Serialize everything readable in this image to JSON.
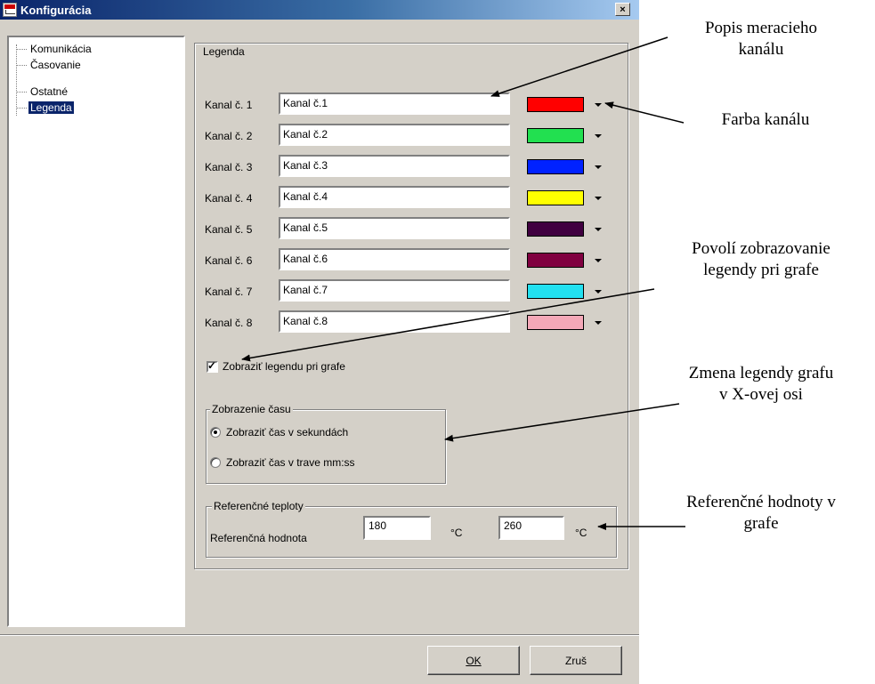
{
  "window": {
    "title": "Konfigurácia",
    "close_label": "×"
  },
  "tree": {
    "items": [
      {
        "label": "Komunikácia",
        "selected": false
      },
      {
        "label": "Časovanie",
        "selected": false
      },
      {
        "label": "Ostatné",
        "selected": false
      },
      {
        "label": "Legenda",
        "selected": true
      }
    ]
  },
  "legenda": {
    "group_label": "Legenda",
    "channels": [
      {
        "label": "Kanal č. 1",
        "value": "Kanal č.1",
        "color": "#ff0000"
      },
      {
        "label": "Kanal č. 2",
        "value": "Kanal č.2",
        "color": "#22e050"
      },
      {
        "label": "Kanal č. 3",
        "value": "Kanal č.3",
        "color": "#0022ff"
      },
      {
        "label": "Kanal č. 4",
        "value": "Kanal č.4",
        "color": "#ffff00"
      },
      {
        "label": "Kanal č. 5",
        "value": "Kanal č.5",
        "color": "#400040"
      },
      {
        "label": "Kanal č. 6",
        "value": "Kanal č.6",
        "color": "#800040"
      },
      {
        "label": "Kanal č. 7",
        "value": "Kanal č.7",
        "color": "#22e0f0"
      },
      {
        "label": "Kanal č. 8",
        "value": "Kanal č.8",
        "color": "#f4a8b8"
      }
    ],
    "show_legend_label": "Zobraziť legendu pri grafe",
    "show_legend_checked": true
  },
  "time_display": {
    "group_label": "Zobrazenie času",
    "options": [
      {
        "label": "Zobraziť čas v sekundách",
        "selected": true
      },
      {
        "label": "Zobraziť čas v trave mm:ss",
        "selected": false
      }
    ]
  },
  "reference": {
    "group_label": "Referenčné teploty",
    "row_label": "Referenčná hodnota",
    "value1": "180",
    "unit1": "°C",
    "value2": "260",
    "unit2": "°C"
  },
  "buttons": {
    "ok": "OK",
    "cancel": "Zruš"
  },
  "annotations": {
    "channel_desc_1": "Popis meracieho",
    "channel_desc_2": "kanálu",
    "channel_color": "Farba kanálu",
    "legend_enable_1": "Povolí zobrazovanie",
    "legend_enable_2": "legendy pri grafe",
    "xaxis_legend_1": "Zmena legendy  grafu",
    "xaxis_legend_2": "v X-ovej osi",
    "ref_values_1": "Referenčné hodnoty v",
    "ref_values_2": "grafe"
  },
  "colors": {
    "titlebar": "#0a246a",
    "dialog_bg": "#d4d0c8",
    "selection": "#0a246a"
  }
}
